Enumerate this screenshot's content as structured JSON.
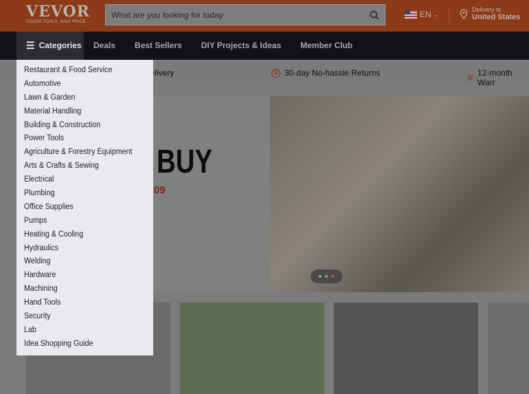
{
  "header": {
    "logo": "VEVOR",
    "logo_tagline": "TOUGH TOOLS, HALF PRICE",
    "search_placeholder": "What are you looking for today",
    "language": "EN",
    "delivery_label": "Delivery to",
    "delivery_country": "United States"
  },
  "nav": {
    "categories": "Categories",
    "items": [
      "Deals",
      "Best Sellers",
      "DIY Projects & Ideas",
      "Member Club"
    ]
  },
  "benefits": [
    "Delivery",
    "30-day No-hassle Returns",
    "12-month Warr"
  ],
  "hero": {
    "headline": "BUY",
    "price_fragment": "09",
    "slides": 3,
    "active_slide": 3
  },
  "categories_menu": [
    "Restaurant & Food Service",
    "Automotive",
    "Lawn & Garden",
    "Material Handling",
    "Building & Construction",
    "Power Tools",
    "Agriculture & Forestry Equipment",
    "Arts & Crafts & Sewing",
    "Electrical",
    "Plumbing",
    "Office Supplies",
    "Pumps",
    "Heating & Cooling",
    "Hydraulics",
    "Welding",
    "Hardware",
    "Machining",
    "Hand Tools",
    "Security",
    "Lab",
    "Idea Shopping Guide"
  ]
}
